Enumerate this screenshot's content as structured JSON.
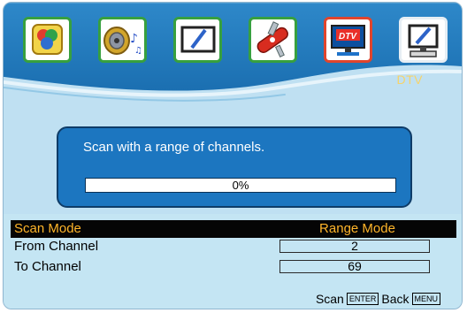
{
  "menu": {
    "title": "DTV",
    "icons": [
      {
        "name": "picture-icon",
        "state": "normal",
        "border_color": "#37a03f"
      },
      {
        "name": "sound-icon",
        "state": "normal",
        "border_color": "#37a03f"
      },
      {
        "name": "screen-icon",
        "state": "normal",
        "border_color": "#37a03f"
      },
      {
        "name": "tools-icon",
        "state": "normal",
        "border_color": "#37a03f"
      },
      {
        "name": "dtv-icon",
        "state": "selected",
        "border_color": "#e0452d"
      },
      {
        "name": "pc-icon",
        "state": "normal",
        "border_color": "#e6eef4"
      }
    ]
  },
  "scan_dialog": {
    "message": "Scan with a range of channels.",
    "progress_text": "0%",
    "progress": 0
  },
  "settings": {
    "scan_mode": {
      "label": "Scan Mode",
      "value": "Range Mode"
    },
    "from_channel": {
      "label": "From Channel",
      "value": "2"
    },
    "to_channel": {
      "label": "To Channel",
      "value": "69"
    }
  },
  "footer": {
    "scan_label": "Scan",
    "scan_key": "ENTER",
    "back_label": "Back",
    "back_key": "MENU"
  },
  "colors": {
    "accent_title": "#f6d36b",
    "dialog_bg": "#1c76c0",
    "selected_row_bg": "#050505",
    "selected_text": "#ffb52a",
    "panel_bg": "#bfe0f2"
  }
}
